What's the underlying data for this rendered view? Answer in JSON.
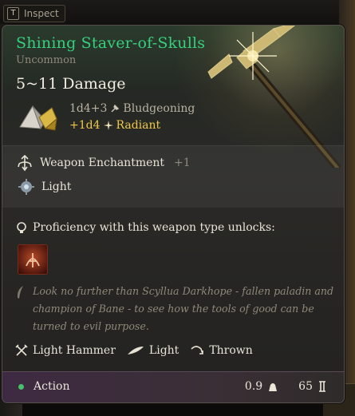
{
  "topbar": {
    "inspect_key": "T",
    "inspect_label": "Inspect"
  },
  "item": {
    "name": "Shining Staver-of-Skulls",
    "rarity": "Uncommon",
    "damage": "5~11 Damage",
    "damage_rolls": [
      {
        "dice": "1d4+3",
        "type": "Bludgeoning",
        "icon": "hammer-icon"
      },
      {
        "dice": "+1d4",
        "type": "Radiant",
        "icon": "radiant-sparkle-icon"
      }
    ],
    "enchantment": {
      "label": "Weapon Enchantment",
      "value": "+1"
    },
    "property_light": "Light",
    "proficiency_label": "Proficiency with this weapon type unlocks:",
    "lore": "Look no further than Scyllua Darkhope - fallen paladin and champion of Bane - to see how the tools of good can be turned to evil purpose.",
    "properties": [
      {
        "label": "Light Hammer",
        "icon": "crossed-hammers-icon"
      },
      {
        "label": "Light",
        "icon": "feather-icon"
      },
      {
        "label": "Thrown",
        "icon": "thrown-arc-icon"
      }
    ],
    "footer": {
      "action_label": "Action",
      "weight": "0.9",
      "value": "65"
    }
  },
  "colors": {
    "name": "#35d07c",
    "radiant": "#f0c847",
    "accent_footer": "#3e2a42"
  },
  "corner_hud": "3"
}
